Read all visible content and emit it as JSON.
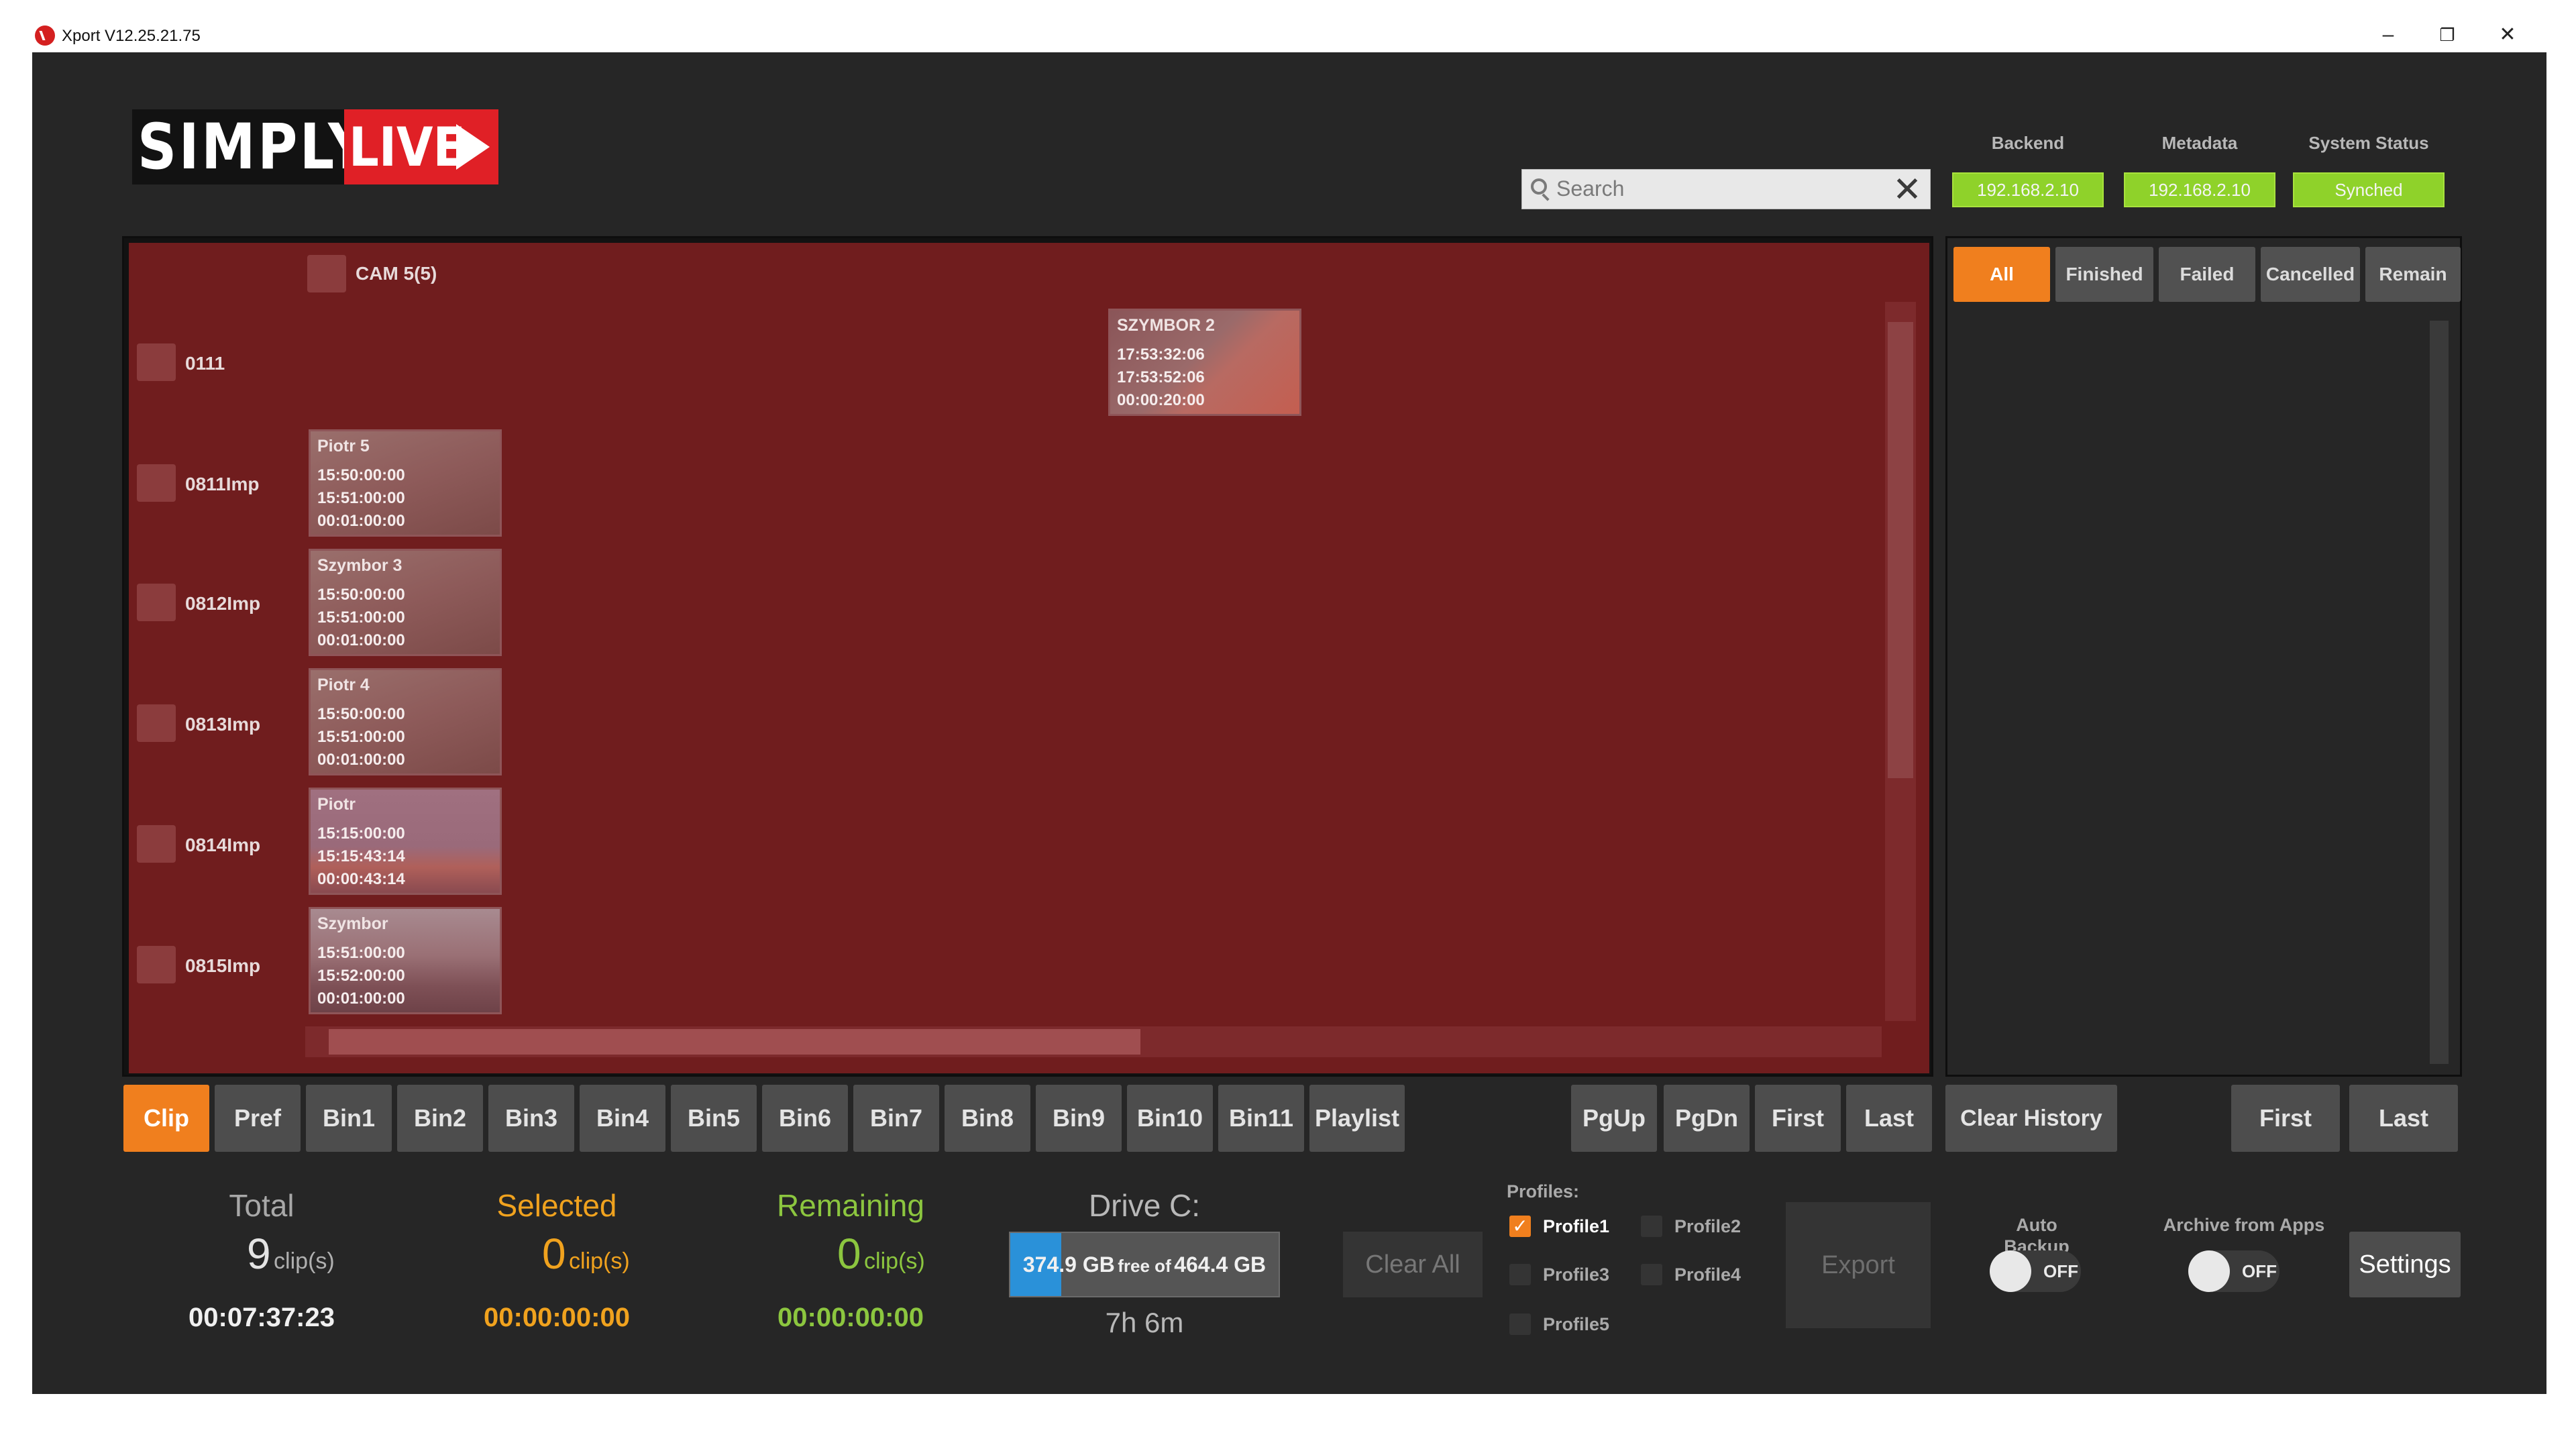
{
  "window": {
    "title": "Xport V12.25.21.75",
    "minimize": "–",
    "restore": "❐",
    "close": "✕"
  },
  "logo": {
    "part1": "SIMPLY",
    "part2": "LIVE"
  },
  "search": {
    "placeholder": "Search",
    "clear": "✕"
  },
  "status": {
    "backend": {
      "label": "Backend",
      "value": "192.168.2.10"
    },
    "metadata": {
      "label": "Metadata",
      "value": "192.168.2.10"
    },
    "system": {
      "label": "System Status",
      "value": "Synched"
    },
    "ok_color": "#8fd22a"
  },
  "clip_panel": {
    "camera_label": "CAM 5(5)",
    "rows": [
      {
        "label": "0111"
      },
      {
        "label": "0811Imp"
      },
      {
        "label": "0812Imp"
      },
      {
        "label": "0813Imp"
      },
      {
        "label": "0814Imp"
      },
      {
        "label": "0815Imp"
      }
    ],
    "clips": [
      {
        "name": "SZYMBOR 2",
        "in": "17:53:32:06",
        "out": "17:53:52:06",
        "duration": "00:00:20:00"
      },
      {
        "name": "Piotr 5",
        "in": "15:50:00:00",
        "out": "15:51:00:00",
        "duration": "00:01:00:00"
      },
      {
        "name": "Szymbor 3",
        "in": "15:50:00:00",
        "out": "15:51:00:00",
        "duration": "00:01:00:00"
      },
      {
        "name": "Piotr 4",
        "in": "15:50:00:00",
        "out": "15:51:00:00",
        "duration": "00:01:00:00"
      },
      {
        "name": "Piotr",
        "in": "15:15:00:00",
        "out": "15:15:43:14",
        "duration": "00:00:43:14"
      },
      {
        "name": "Szymbor",
        "in": "15:51:00:00",
        "out": "15:52:00:00",
        "duration": "00:01:00:00"
      }
    ]
  },
  "filters": [
    "All",
    "Finished",
    "Failed",
    "Cancelled",
    "Remain"
  ],
  "bins": [
    "Clip",
    "Pref",
    "Bin1",
    "Bin2",
    "Bin3",
    "Bin4",
    "Bin5",
    "Bin6",
    "Bin7",
    "Bin8",
    "Bin9",
    "Bin10",
    "Bin11",
    "Playlist"
  ],
  "nav": {
    "pgup": "PgUp",
    "pgdn": "PgDn",
    "first": "First",
    "last": "Last"
  },
  "history": {
    "clear": "Clear History",
    "first": "First",
    "last": "Last"
  },
  "stats": {
    "total": {
      "title": "Total",
      "count": "9",
      "unit": "clip(s)",
      "time": "00:07:37:23"
    },
    "selected": {
      "title": "Selected",
      "count": "0",
      "unit": "clip(s)",
      "time": "00:00:00:00"
    },
    "remaining": {
      "title": "Remaining",
      "count": "0",
      "unit": "clip(s)",
      "time": "00:00:00:00"
    }
  },
  "drive": {
    "title": "Drive C:",
    "free": "374.9 GB",
    "free_of": "free of",
    "total": "464.4 GB",
    "time_left": "7h 6m",
    "used_fraction": 0.19
  },
  "clear_all": "Clear All",
  "profiles": {
    "title": "Profiles:",
    "items": [
      {
        "label": "Profile1",
        "checked": true
      },
      {
        "label": "Profile2",
        "checked": false
      },
      {
        "label": "Profile3",
        "checked": false
      },
      {
        "label": "Profile4",
        "checked": false
      },
      {
        "label": "Profile5",
        "checked": false
      }
    ]
  },
  "export": "Export",
  "auto_backup": {
    "label": "Auto Backup",
    "state": "OFF"
  },
  "archive": {
    "label": "Archive from Apps",
    "state": "OFF"
  },
  "settings": "Settings",
  "colors": {
    "accent": "#f07f1e",
    "selected": "#f0a21e",
    "remaining": "#8cc63f",
    "panel": "#701d1e",
    "drive": "#2a91d9"
  }
}
